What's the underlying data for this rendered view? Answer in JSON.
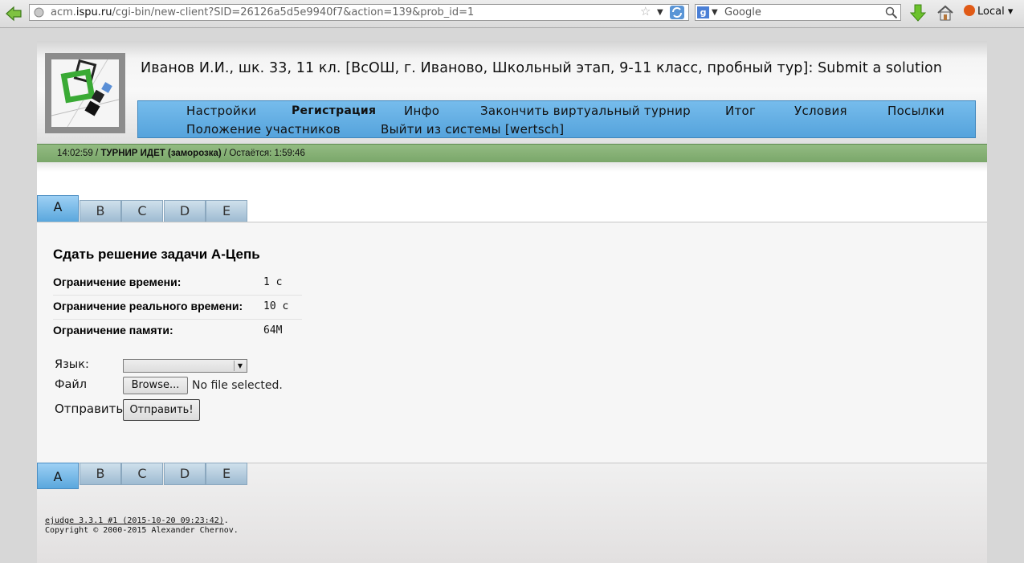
{
  "browser": {
    "url_prefix": "acm.",
    "url_domain": "ispu.ru",
    "url_rest": "/cgi-bin/new-client?SID=26126a5d5e9940f7&action=139&prob_id=1",
    "search_placeholder": "Google",
    "profile_label": "Local"
  },
  "header": {
    "user_title": "Иванов И.И., шк. 33, 11 кл. [ВсОШ, г. Иваново, Школьный этап, 9-11 класс, пробный тур]: Submit a solution"
  },
  "menu": {
    "items": [
      {
        "label": "Настройки"
      },
      {
        "label": "Регистрация"
      },
      {
        "label": "Инфо"
      },
      {
        "label": "Закончить виртуальный турнир"
      },
      {
        "label": "Итог"
      },
      {
        "label": "Условия"
      },
      {
        "label": "Посылки"
      },
      {
        "label": "Положение участников"
      },
      {
        "label": "Выйти из системы [wertsch]"
      }
    ]
  },
  "status": {
    "time": "14:02:59 / ",
    "state": "ТУРНИР ИДЕТ (заморозка)",
    "remaining": " / Остаётся: 1:59:46"
  },
  "tabs": {
    "items": [
      "A",
      "B",
      "C",
      "D",
      "E"
    ],
    "active": "A"
  },
  "problem": {
    "title": "Сдать решение задачи A-Цепь",
    "limits": [
      {
        "label": "Ограничение времени:",
        "value": "1 с"
      },
      {
        "label": "Ограничение реального времени:",
        "value": "10 с"
      },
      {
        "label": "Ограничение памяти:",
        "value": "64M"
      }
    ]
  },
  "form": {
    "language_label": "Язык:",
    "language_value": "",
    "file_label": "Файл",
    "browse_label": "Browse...",
    "no_file_text": "No file selected.",
    "send_label": "Отправить!",
    "send_button_label": "Отправить!"
  },
  "footer": {
    "version_link": "ejudge 3.3.1 #1 (2015-10-20 09:23:42)",
    "version_suffix": ".",
    "copyright": "Copyright © 2000-2015 Alexander Chernov."
  }
}
